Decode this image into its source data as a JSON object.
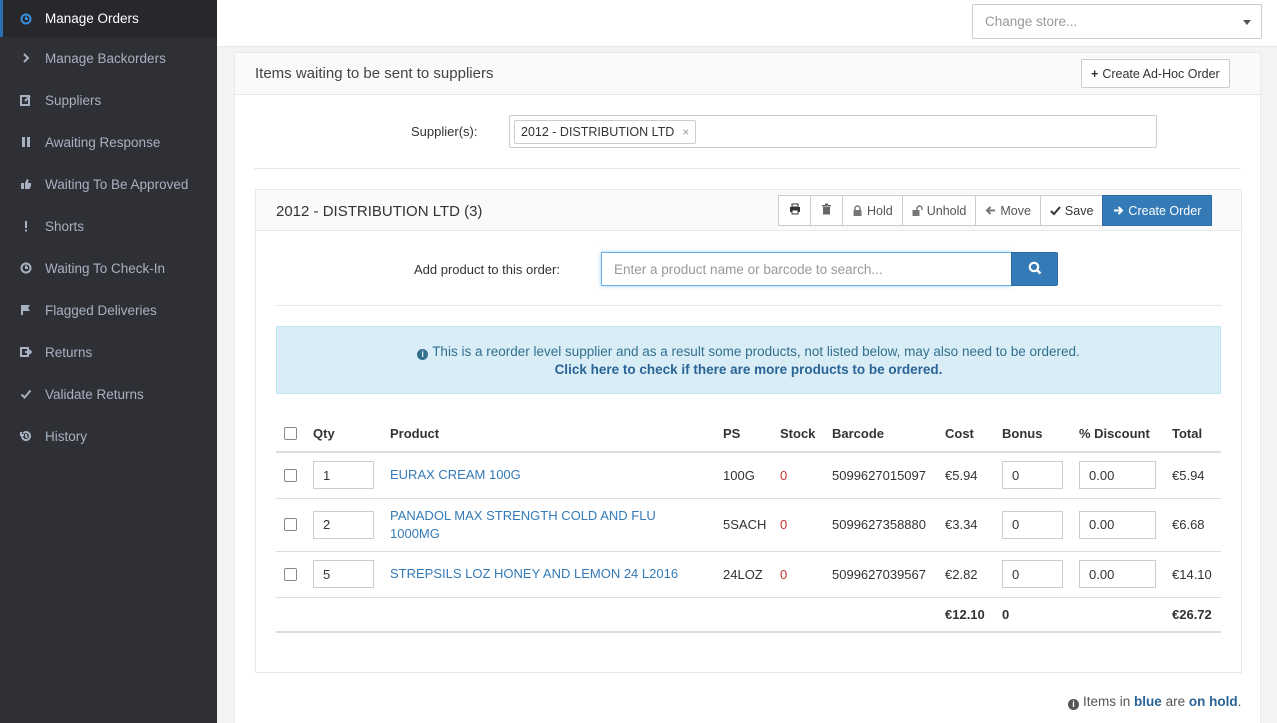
{
  "sidebar": {
    "items": [
      {
        "label": "Manage Orders",
        "icon": "clock-icon",
        "active": true
      },
      {
        "label": "Manage Backorders",
        "icon": "chevron-right-icon"
      },
      {
        "label": "Suppliers",
        "icon": "edit-icon"
      },
      {
        "label": "Awaiting Response",
        "icon": "pause-icon"
      },
      {
        "label": "Waiting To Be Approved",
        "icon": "thumbs-up-icon"
      },
      {
        "label": "Shorts",
        "icon": "exclamation-icon"
      },
      {
        "label": "Waiting To Check-In",
        "icon": "clock-icon"
      },
      {
        "label": "Flagged Deliveries",
        "icon": "flag-icon"
      },
      {
        "label": "Returns",
        "icon": "return-icon"
      },
      {
        "label": "Validate Returns",
        "icon": "check-icon"
      },
      {
        "label": "History",
        "icon": "history-icon"
      }
    ]
  },
  "topbar": {
    "store_placeholder": "Change store..."
  },
  "panel": {
    "title": "Items waiting to be sent to suppliers",
    "adhoc_label": "Create Ad-Hoc Order",
    "supplier_label": "Supplier(s):",
    "supplier_tag": "2012 - DISTRIBUTION LTD",
    "tag_close": "×"
  },
  "order": {
    "title": "2012 - DISTRIBUTION LTD (3)",
    "toolbar": {
      "hold": "Hold",
      "unhold": "Unhold",
      "move": "Move",
      "save": "Save",
      "create": "Create Order"
    },
    "add_label": "Add product to this order:",
    "search_placeholder": "Enter a product name or barcode to search...",
    "info_text": "This is a reorder level supplier and as a result some products, not listed below, may also need to be ordered.",
    "info_link": "Click here to check if there are more products to be ordered.",
    "columns": [
      "Qty",
      "Product",
      "PS",
      "Stock",
      "Barcode",
      "Cost",
      "Bonus",
      "% Discount",
      "Total"
    ],
    "rows": [
      {
        "qty": "1",
        "product": "EURAX CREAM 100G",
        "ps": "100G",
        "stock": "0",
        "barcode": "5099627015097",
        "cost": "€5.94",
        "bonus": "0",
        "discount": "0.00",
        "total": "€5.94"
      },
      {
        "qty": "2",
        "product": "PANADOL MAX STRENGTH COLD AND FLU 1000MG",
        "ps": "5SACH",
        "stock": "0",
        "barcode": "5099627358880",
        "cost": "€3.34",
        "bonus": "0",
        "discount": "0.00",
        "total": "€6.68"
      },
      {
        "qty": "5",
        "product": "STREPSILS LOZ HONEY AND LEMON 24 L2016",
        "ps": "24LOZ",
        "stock": "0",
        "barcode": "5099627039567",
        "cost": "€2.82",
        "bonus": "0",
        "discount": "0.00",
        "total": "€14.10"
      }
    ],
    "totals": {
      "cost": "€12.10",
      "bonus": "0",
      "total": "€26.72"
    }
  },
  "footnote": {
    "pre": "Items in",
    "blue": "blue",
    "mid": "are",
    "hold": "on hold",
    "end": "."
  },
  "colors": {
    "sidebar_bg": "#2f3035",
    "primary": "#337ab7",
    "info_bg": "#d9edf7",
    "stock_red": "#c9302c"
  }
}
